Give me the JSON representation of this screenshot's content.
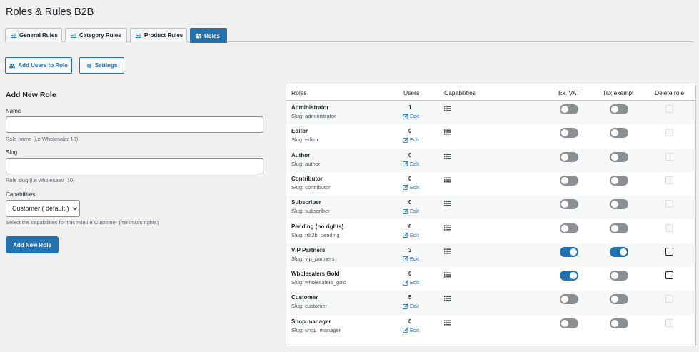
{
  "page": {
    "title": "Roles & Rules B2B"
  },
  "tabs": [
    {
      "label": "General Rules",
      "icon": "sliders-icon",
      "active": false
    },
    {
      "label": "Category Rules",
      "icon": "sliders-icon",
      "active": false
    },
    {
      "label": "Product Rules",
      "icon": "sliders-icon",
      "active": false
    },
    {
      "label": "Roles",
      "icon": "users-icon",
      "active": true
    }
  ],
  "actions": {
    "add_users_label": "Add Users to Role",
    "settings_label": "Settings"
  },
  "form": {
    "title": "Add New Role",
    "name_label": "Name",
    "name_value": "",
    "name_hint": "Role name (i.e Wholesaler 10)",
    "slug_label": "Slug",
    "slug_value": "",
    "slug_hint": "Role slug (i.e wholesaler_10)",
    "capabilities_label": "Capabilities",
    "capabilities_selected": "Customer ( default )",
    "capabilities_hint": "Select the capabilities for this role i.e Customer (minimum rights)",
    "submit_label": "Add New Role"
  },
  "table": {
    "headers": {
      "roles": "Roles",
      "users": "Users",
      "capabilities": "Capabilities",
      "ex_vat": "Ex. VAT",
      "tax_exempt": "Tax exempt",
      "delete_role": "Delete role"
    },
    "edit_label": "Edit",
    "rows": [
      {
        "name": "Administrator",
        "slug": "Slug: administrator",
        "users": "1",
        "ex_vat": false,
        "tax_exempt": false,
        "deletable": false
      },
      {
        "name": "Editor",
        "slug": "Slug: editor",
        "users": "0",
        "ex_vat": false,
        "tax_exempt": false,
        "deletable": false
      },
      {
        "name": "Author",
        "slug": "Slug: author",
        "users": "0",
        "ex_vat": false,
        "tax_exempt": false,
        "deletable": false
      },
      {
        "name": "Contributor",
        "slug": "Slug: contributor",
        "users": "0",
        "ex_vat": false,
        "tax_exempt": false,
        "deletable": false
      },
      {
        "name": "Subscriber",
        "slug": "Slug: subscriber",
        "users": "0",
        "ex_vat": false,
        "tax_exempt": false,
        "deletable": false
      },
      {
        "name": "Pending (no rights)",
        "slug": "Slug: rrb2b_pending",
        "users": "0",
        "ex_vat": false,
        "tax_exempt": false,
        "deletable": false
      },
      {
        "name": "VIP Partners",
        "slug": "Slug: vip_partners",
        "users": "3",
        "ex_vat": true,
        "tax_exempt": true,
        "deletable": true
      },
      {
        "name": "Wholesalers Gold",
        "slug": "Slug: wholesalers_gold",
        "users": "0",
        "ex_vat": true,
        "tax_exempt": false,
        "deletable": true
      },
      {
        "name": "Customer",
        "slug": "Slug: customer",
        "users": "5",
        "ex_vat": false,
        "tax_exempt": false,
        "deletable": false
      },
      {
        "name": "Shop manager",
        "slug": "Slug: shop_manager",
        "users": "0",
        "ex_vat": false,
        "tax_exempt": false,
        "deletable": false
      }
    ]
  },
  "colors": {
    "accent": "#2271b1",
    "toggle_off": "#8c8f94"
  }
}
